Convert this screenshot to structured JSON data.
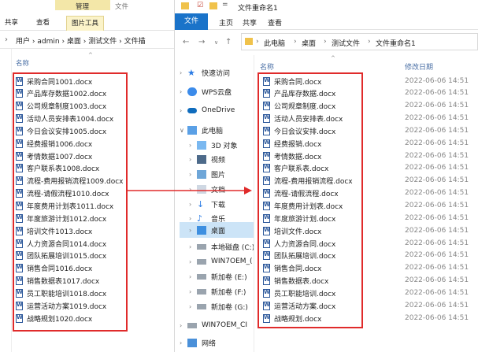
{
  "left_window": {
    "ribbon_context": "管理",
    "ribbon_file_hint": "文件",
    "tabs": [
      "共享",
      "查看",
      "图片工具"
    ],
    "breadcrumb": [
      "用户",
      "admin",
      "桌面",
      "测试文件",
      "文件描"
    ],
    "column_name": "名称",
    "files": [
      "采购合同1001.docx",
      "产品库存数据1002.docx",
      "公司规章制度1003.docx",
      "活动人员安排表1004.docx",
      "今日会议安排1005.docx",
      "经费报销1006.docx",
      "考情数据1007.docx",
      "客户联系表1008.docx",
      "流程-费用报销流程1009.docx",
      "流程-请假流程1010.docx",
      "年度费用计划表1011.docx",
      "年度旅游计划1012.docx",
      "培训文件1013.docx",
      "人力资源合同1014.docx",
      "团队拓展培训1015.docx",
      "销售合同1016.docx",
      "销售数据表1017.docx",
      "员工职能培训1018.docx",
      "运营活动方案1019.docx",
      "战略规划1020.docx"
    ]
  },
  "right_window": {
    "title": "文件重命名1",
    "ribbon": {
      "file": "文件",
      "tabs": [
        "主页",
        "共享",
        "查看"
      ]
    },
    "breadcrumb": [
      "此电脑",
      "桌面",
      "测试文件",
      "文件重命名1"
    ],
    "columns": {
      "name": "名称",
      "modified": "修改日期"
    },
    "sidebar": [
      {
        "label": "快速访问",
        "icon": "star-icon"
      },
      {
        "label": "WPS云盘",
        "icon": "cloud-icon"
      },
      {
        "label": "OneDrive",
        "icon": "onedrive-icon"
      },
      {
        "label": "此电脑",
        "icon": "computer-icon"
      },
      {
        "label": "3D 对象",
        "icon": "cube-icon"
      },
      {
        "label": "视频",
        "icon": "video-icon"
      },
      {
        "label": "图片",
        "icon": "picture-icon"
      },
      {
        "label": "文档",
        "icon": "document-icon"
      },
      {
        "label": "下载",
        "icon": "download-icon"
      },
      {
        "label": "音乐",
        "icon": "music-icon"
      },
      {
        "label": "桌面",
        "icon": "desktop-icon"
      },
      {
        "label": "本地磁盘 (C:)",
        "icon": "drive-icon"
      },
      {
        "label": "WIN7OEM_(",
        "icon": "drive-icon"
      },
      {
        "label": "新加卷 (E:)",
        "icon": "drive-icon"
      },
      {
        "label": "新加卷 (F:)",
        "icon": "drive-icon"
      },
      {
        "label": "新加卷 (G:)",
        "icon": "drive-icon"
      },
      {
        "label": "WIN7OEM_CI",
        "icon": "drive-icon"
      },
      {
        "label": "网络",
        "icon": "network-icon"
      }
    ],
    "files": [
      {
        "name": "采购合同.docx",
        "date": "2022-06-06 14:51"
      },
      {
        "name": "产品库存数据.docx",
        "date": "2022-06-06 14:51"
      },
      {
        "name": "公司规章制度.docx",
        "date": "2022-06-06 14:51"
      },
      {
        "name": "活动人员安排表.docx",
        "date": "2022-06-06 14:51"
      },
      {
        "name": "今日会议安排.docx",
        "date": "2022-06-06 14:51"
      },
      {
        "name": "经费报销.docx",
        "date": "2022-06-06 14:51"
      },
      {
        "name": "考情数据.docx",
        "date": "2022-06-06 14:51"
      },
      {
        "name": "客户联系表.docx",
        "date": "2022-06-06 14:51"
      },
      {
        "name": "流程-费用报销流程.docx",
        "date": "2022-06-06 14:51"
      },
      {
        "name": "流程-请假流程.docx",
        "date": "2022-06-06 14:51"
      },
      {
        "name": "年度费用计划表.docx",
        "date": "2022-06-06 14:51"
      },
      {
        "name": "年度旅游计划.docx",
        "date": "2022-06-06 14:51"
      },
      {
        "name": "培训文件.docx",
        "date": "2022-06-06 14:51"
      },
      {
        "name": "人力资源合同.docx",
        "date": "2022-06-06 14:51"
      },
      {
        "name": "团队拓展培训.docx",
        "date": "2022-06-06 14:51"
      },
      {
        "name": "销售合同.docx",
        "date": "2022-06-06 14:51"
      },
      {
        "name": "销售数据表.docx",
        "date": "2022-06-06 14:51"
      },
      {
        "name": "员工职能培训.docx",
        "date": "2022-06-06 14:51"
      },
      {
        "name": "运营活动方案.docx",
        "date": "2022-06-06 14:51"
      },
      {
        "name": "战略规划.docx",
        "date": "2022-06-06 14:51"
      }
    ]
  },
  "colors": {
    "accent": "#1a73c9",
    "highlight": "#e02b2b",
    "selected": "#cce4f7",
    "tool_tab": "#fbf3c9"
  }
}
